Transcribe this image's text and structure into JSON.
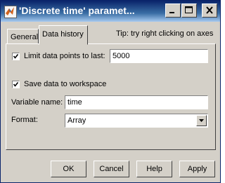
{
  "window": {
    "title": "'Discrete time' paramet...",
    "app_icon": "matlab-icon",
    "controls": [
      "minimize-icon",
      "maximize-icon",
      "close-icon"
    ]
  },
  "tabs": {
    "general": "General",
    "data_history": "Data history",
    "active": "Data history"
  },
  "tip": "Tip: try right clicking on axes",
  "limit": {
    "checked": true,
    "label": "Limit data points to last:",
    "value": "5000"
  },
  "save": {
    "checked": true,
    "label": "Save data to workspace"
  },
  "variable": {
    "label": "Variable name:",
    "value": "time"
  },
  "format": {
    "label": "Format:",
    "value": "Array"
  },
  "buttons": {
    "ok": "OK",
    "cancel": "Cancel",
    "help": "Help",
    "apply": "Apply"
  }
}
